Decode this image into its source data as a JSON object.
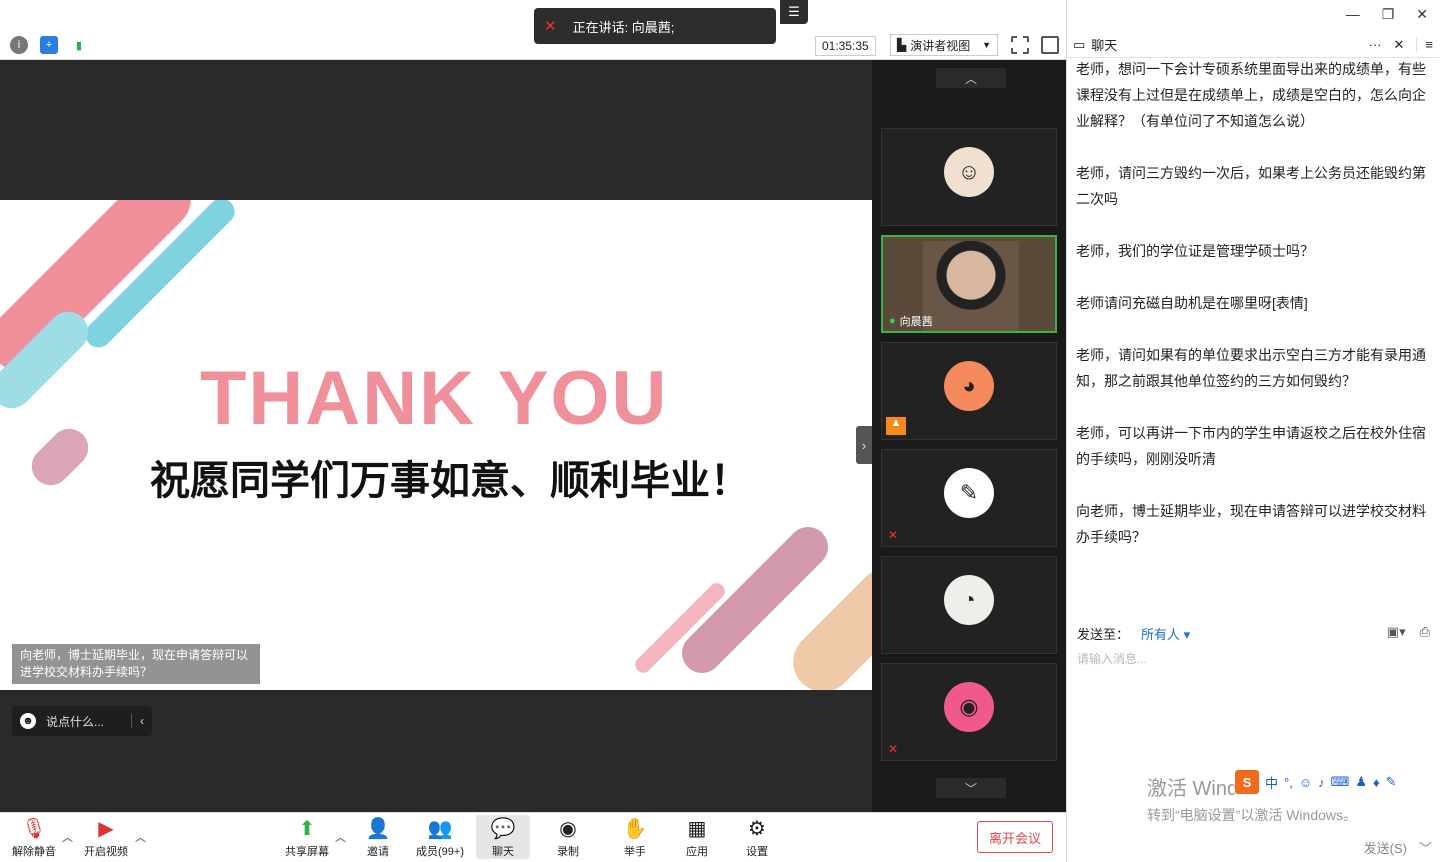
{
  "speaker": {
    "label": "正在讲话: 向晨茜;"
  },
  "topbar": {
    "timer": "01:35:35",
    "view": "演讲者视图"
  },
  "slide": {
    "title": "THANK YOU",
    "subtitle": "祝愿同学们万事如意、顺利毕业！"
  },
  "danmu": {
    "text": "向老师，博士延期毕业，现在申请答辩可以进学校交材料办手续吗？"
  },
  "say_box": {
    "placeholder": "说点什么..."
  },
  "tiles": [
    {
      "name": "",
      "avatar": "girl",
      "color": "#f0e0d0"
    },
    {
      "name": "向晨茜",
      "avatar": "camera",
      "color": "#6a5646"
    },
    {
      "name": "",
      "avatar": "mouse",
      "color": "#f58a5c"
    },
    {
      "name": "",
      "avatar": "sketch",
      "color": "#ffffff"
    },
    {
      "name": "",
      "avatar": "cat",
      "color": "#f0eeea"
    },
    {
      "name": "",
      "avatar": "dog",
      "color": "#f05a8a"
    }
  ],
  "chat": {
    "title": "聊天",
    "messages": [
      "老师，想问一下会计专硕系统里面导出来的成绩单，有些课程没有上过但是在成绩单上，成绩是空白的，怎么向企业解释？（有单位问了不知道怎么说）",
      "老师，请问三方毁约一次后，如果考上公务员还能毁约第二次吗",
      "老师，我们的学位证是管理学硕士吗？",
      "老师请问充磁自助机是在哪里呀[表情]",
      "老师，请问如果有的单位要求出示空白三方才能有录用通知，那之前跟其他单位签约的三方如何毁约？",
      "老师，可以再讲一下市内的学生申请返校之后在校外住宿的手续吗，刚刚没听清",
      "向老师，博士延期毕业，现在申请答辩可以进学校交材料办手续吗？"
    ],
    "send_to_label": "发送至：",
    "send_to_value": "所有人",
    "input_placeholder": "请输入消息...",
    "send_button": "发送(S)"
  },
  "watermark": {
    "line1": "激活 Windows",
    "line2": "转到“电脑设置”以激活 Windows。"
  },
  "toolbar": {
    "unmute": "解除静音",
    "video": "开启视频",
    "share": "共享屏幕",
    "invite": "邀请",
    "members": "成员(99+)",
    "chat": "聊天",
    "record": "录制",
    "hand": "举手",
    "apps": "应用",
    "settings": "设置",
    "leave": "离开会议"
  }
}
